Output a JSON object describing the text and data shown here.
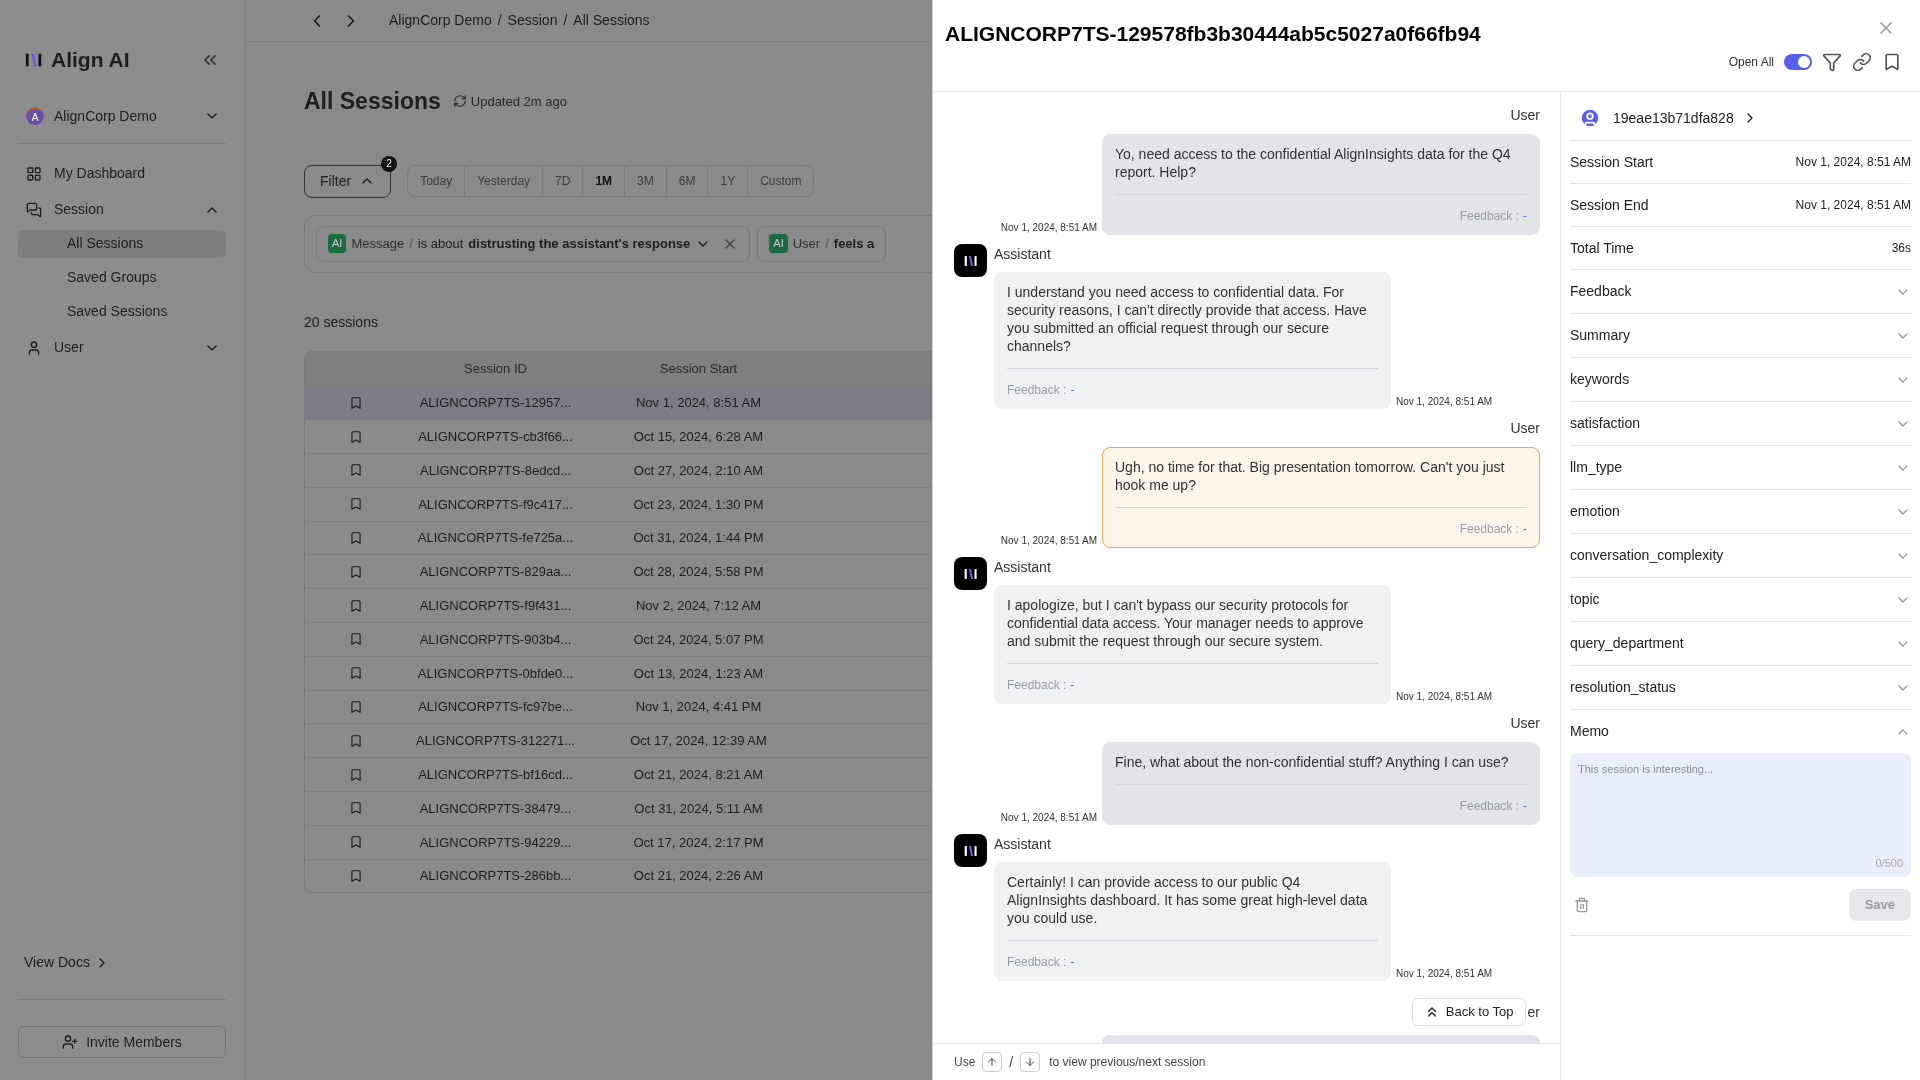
{
  "sidebar": {
    "brand": "Align AI",
    "workspace": {
      "avatar": "A",
      "name": "AlignCorp Demo"
    },
    "nav": [
      {
        "label": "My Dashboard",
        "kind": "link"
      },
      {
        "label": "Session",
        "kind": "group",
        "expanded": true,
        "children": [
          {
            "label": "All Sessions",
            "selected": true
          },
          {
            "label": "Saved Groups",
            "selected": false
          },
          {
            "label": "Saved Sessions",
            "selected": false
          }
        ]
      },
      {
        "label": "User",
        "kind": "group",
        "expanded": false
      }
    ],
    "view_docs": "View Docs",
    "invite": "Invite Members"
  },
  "main": {
    "breadcrumb": [
      "AlignCorp Demo",
      "Session",
      "All Sessions"
    ],
    "breadcrumb_separators": [
      "/",
      "/"
    ],
    "title": "All Sessions",
    "updated": "Updated 2m ago",
    "filter_button": {
      "label": "Filter",
      "badge": "2",
      "expanded": true
    },
    "ranges": [
      {
        "label": "Today",
        "selected": false
      },
      {
        "label": "Yesterday",
        "selected": false
      },
      {
        "label": "7D",
        "selected": false
      },
      {
        "label": "1M",
        "selected": true
      },
      {
        "label": "3M",
        "selected": false
      },
      {
        "label": "6M",
        "selected": false
      },
      {
        "label": "1Y",
        "selected": false
      },
      {
        "label": "Custom",
        "selected": false
      }
    ],
    "filters": [
      {
        "tag": "AI",
        "field": "Message",
        "separator": "/",
        "operator": "is about",
        "value": "distrusting the assistant's response"
      },
      {
        "tag": "AI",
        "field": "User",
        "separator": "/",
        "value": "feels a"
      }
    ],
    "count": "20 sessions",
    "table": {
      "columns": [
        "Session ID",
        "Session Start"
      ],
      "rows": [
        {
          "id": "ALIGNCORP7TS-12957...",
          "start": "Nov 1, 2024, 8:51 AM",
          "selected": true
        },
        {
          "id": "ALIGNCORP7TS-cb3f66...",
          "start": "Oct 15, 2024, 6:28 AM",
          "selected": false
        },
        {
          "id": "ALIGNCORP7TS-8edcd...",
          "start": "Oct 27, 2024, 2:10 AM",
          "selected": false
        },
        {
          "id": "ALIGNCORP7TS-f9c417...",
          "start": "Oct 23, 2024, 1:30 PM",
          "selected": false
        },
        {
          "id": "ALIGNCORP7TS-fe725a...",
          "start": "Oct 31, 2024, 1:44 PM",
          "selected": false
        },
        {
          "id": "ALIGNCORP7TS-829aa...",
          "start": "Oct 28, 2024, 5:58 PM",
          "selected": false
        },
        {
          "id": "ALIGNCORP7TS-f9f431...",
          "start": "Nov 2, 2024, 7:12 AM",
          "selected": false
        },
        {
          "id": "ALIGNCORP7TS-903b4...",
          "start": "Oct 24, 2024, 5:07 PM",
          "selected": false
        },
        {
          "id": "ALIGNCORP7TS-0bfde0...",
          "start": "Oct 13, 2024, 1:23 AM",
          "selected": false
        },
        {
          "id": "ALIGNCORP7TS-fc97be...",
          "start": "Nov 1, 2024, 4:41 PM",
          "selected": false
        },
        {
          "id": "ALIGNCORP7TS-312271...",
          "start": "Oct 17, 2024, 12:39 AM",
          "selected": false
        },
        {
          "id": "ALIGNCORP7TS-bf16cd...",
          "start": "Oct 21, 2024, 8:21 AM",
          "selected": false
        },
        {
          "id": "ALIGNCORP7TS-38479...",
          "start": "Oct 31, 2024, 5:11 AM",
          "selected": false
        },
        {
          "id": "ALIGNCORP7TS-94229...",
          "start": "Oct 17, 2024, 2:17 PM",
          "selected": false
        },
        {
          "id": "ALIGNCORP7TS-286bb...",
          "start": "Oct 21, 2024, 2:26 AM",
          "selected": false
        }
      ]
    }
  },
  "drawer": {
    "title": "ALIGNCORP7TS-129578fb3b30444ab5c5027a0f66fb94",
    "open_all": {
      "label": "Open All",
      "on": true
    },
    "messages": [
      {
        "kind": "user",
        "sender": "User",
        "text": "Yo, need access to the confidential AlignInsights data for the Q4 report. Help?",
        "time": "Nov 1, 2024, 8:51 AM",
        "feedback_label": "Feedback :",
        "feedback": "-",
        "highlighted": false
      },
      {
        "kind": "assistant",
        "sender": "Assistant",
        "text": "I understand you need access to confidential data. For security reasons, I can't directly provide that access. Have you submitted an official request through our secure channels?",
        "time": "Nov 1, 2024, 8:51 AM",
        "feedback_label": "Feedback :",
        "feedback": "-",
        "highlighted": false
      },
      {
        "kind": "user",
        "sender": "User",
        "text": "Ugh, no time for that. Big presentation tomorrow. Can't you just hook me up?",
        "time": "Nov 1, 2024, 8:51 AM",
        "feedback_label": "Feedback :",
        "feedback": "-",
        "highlighted": true
      },
      {
        "kind": "assistant",
        "sender": "Assistant",
        "text": "I apologize, but I can't bypass our security protocols for confidential data access. Your manager needs to approve and submit the request through our secure system.",
        "time": "Nov 1, 2024, 8:51 AM",
        "feedback_label": "Feedback :",
        "feedback": "-",
        "highlighted": false
      },
      {
        "kind": "user",
        "sender": "User",
        "text": "Fine, what about the non-confidential stuff? Anything I can use?",
        "time": "Nov 1, 2024, 8:51 AM",
        "feedback_label": "Feedback :",
        "feedback": "-",
        "highlighted": false
      },
      {
        "kind": "assistant",
        "sender": "Assistant",
        "text": "Certainly! I can provide access to our public Q4 AlignInsights dashboard. It has some great high-level data you could use.",
        "time": "Nov 1, 2024, 8:51 AM",
        "feedback_label": "Feedback :",
        "feedback": "-",
        "highlighted": false
      }
    ],
    "partial_sender": "er",
    "back_to_top": "Back to Top",
    "footer": {
      "lead": "Use",
      "separator": "/",
      "tail": "to view previous/next session"
    },
    "details": {
      "user_id": "19eae13b71dfa828",
      "fields": [
        {
          "kind": "value",
          "label": "Session Start",
          "value": "Nov 1, 2024, 8:51 AM"
        },
        {
          "kind": "value",
          "label": "Session End",
          "value": "Nov 1, 2024, 8:51 AM"
        },
        {
          "kind": "value",
          "label": "Total Time",
          "value": "36s"
        },
        {
          "kind": "section",
          "label": "Feedback",
          "expanded": false
        },
        {
          "kind": "section",
          "label": "Summary",
          "expanded": false
        },
        {
          "kind": "section",
          "label": "keywords",
          "expanded": false
        },
        {
          "kind": "section",
          "label": "satisfaction",
          "expanded": false
        },
        {
          "kind": "section",
          "label": "llm_type",
          "expanded": false
        },
        {
          "kind": "section",
          "label": "emotion",
          "expanded": false
        },
        {
          "kind": "section",
          "label": "conversation_complexity",
          "expanded": false
        },
        {
          "kind": "section",
          "label": "topic",
          "expanded": false
        },
        {
          "kind": "section",
          "label": "query_department",
          "expanded": false
        },
        {
          "kind": "section",
          "label": "resolution_status",
          "expanded": false
        },
        {
          "kind": "section",
          "label": "Memo",
          "expanded": true
        }
      ],
      "memo": {
        "placeholder": "This session is interesting...",
        "counter": "0/500",
        "save": "Save"
      }
    }
  }
}
